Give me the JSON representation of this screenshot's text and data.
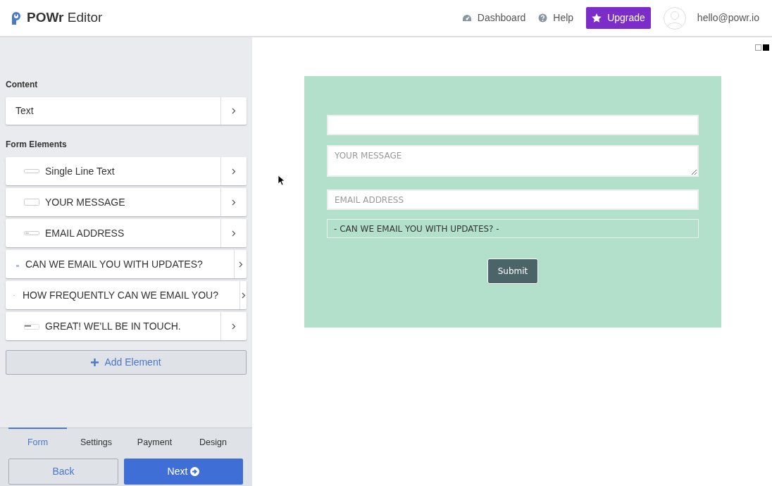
{
  "header": {
    "brand_bold": "POWr",
    "brand_rest": "Editor",
    "nav": [
      {
        "kind": "dashboard",
        "label": "Dashboard"
      },
      {
        "kind": "help",
        "label": "Help"
      }
    ],
    "upgrade": "Upgrade",
    "user": "hello@powr.io"
  },
  "sidebar": {
    "content_heading": "Content",
    "content_items": [
      {
        "label": "Text"
      }
    ],
    "form_heading": "Form Elements",
    "form_items": [
      {
        "kind": "text",
        "label": "Single Line Text"
      },
      {
        "kind": "textarea",
        "label": "YOUR MESSAGE"
      },
      {
        "kind": "email",
        "label": "EMAIL ADDRESS"
      },
      {
        "kind": "checkbox",
        "label": "CAN WE EMAIL YOU WITH UPDATES?"
      },
      {
        "kind": "radio",
        "label": "HOW FREQUENTLY CAN WE EMAIL YOU?"
      },
      {
        "kind": "message",
        "label": "GREAT! WE'LL BE IN TOUCH."
      }
    ],
    "add_button": "Add Element",
    "tabs": [
      {
        "label": "Form",
        "selected": true
      },
      {
        "label": "Settings",
        "selected": false
      },
      {
        "label": "Payment",
        "selected": false
      },
      {
        "label": "Design",
        "selected": false
      }
    ],
    "back": "Back",
    "next": "Next"
  },
  "preview": {
    "fields": [
      {
        "kind": "input"
      },
      {
        "kind": "textarea",
        "placeholder": "YOUR MESSAGE"
      },
      {
        "kind": "input",
        "placeholder": "EMAIL ADDRESS"
      },
      {
        "kind": "select",
        "value": "- CAN WE EMAIL YOU WITH UPDATES? -"
      }
    ],
    "submit": "Submit"
  }
}
